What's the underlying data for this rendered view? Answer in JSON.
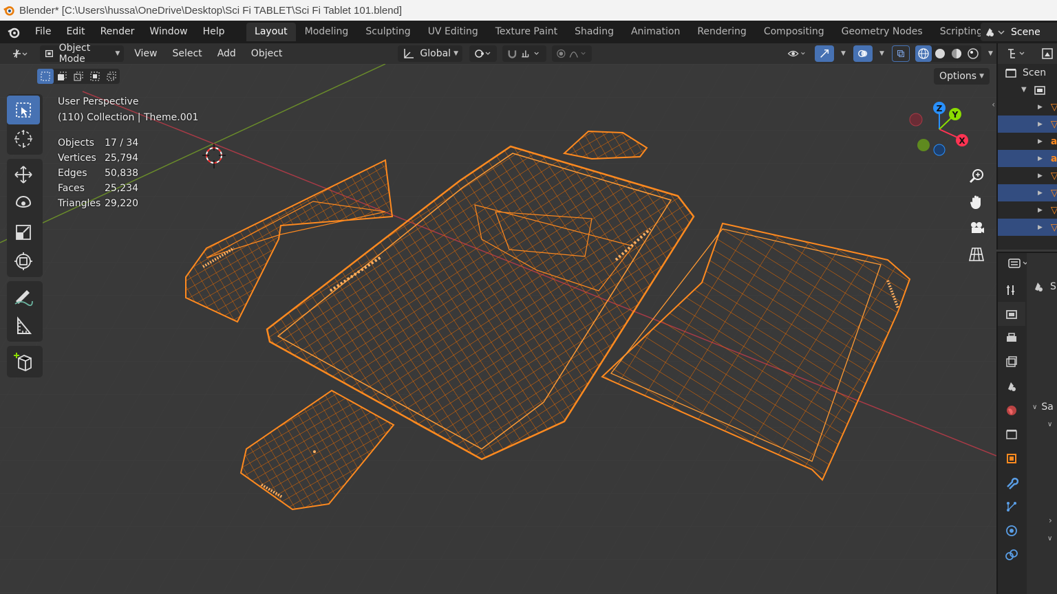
{
  "window": {
    "title": "Blender* [C:\\Users\\hussa\\OneDrive\\Desktop\\Sci Fi TABLET\\Sci Fi Tablet 101.blend]"
  },
  "menu": {
    "items": [
      "File",
      "Edit",
      "Render",
      "Window",
      "Help"
    ]
  },
  "workspaces": {
    "tabs": [
      "Layout",
      "Modeling",
      "Sculpting",
      "UV Editing",
      "Texture Paint",
      "Shading",
      "Animation",
      "Rendering",
      "Compositing",
      "Geometry Nodes",
      "Scripting"
    ],
    "active": "Layout"
  },
  "scene": {
    "label": "Scene"
  },
  "viewport_header": {
    "mode": "Object Mode",
    "menus": [
      "View",
      "Select",
      "Add",
      "Object"
    ],
    "orientation": "Global",
    "options_label": "Options"
  },
  "overlay": {
    "view_name": "User Perspective",
    "collection_info": "(110) Collection | Theme.001",
    "stats": [
      {
        "label": "Objects",
        "value": "17 / 34"
      },
      {
        "label": "Vertices",
        "value": "25,794"
      },
      {
        "label": "Edges",
        "value": "50,838"
      },
      {
        "label": "Faces",
        "value": "25,234"
      },
      {
        "label": "Triangles",
        "value": "29,220"
      }
    ]
  },
  "gizmo": {
    "x": "X",
    "y": "Y",
    "z": "Z"
  },
  "outliner": {
    "header_text": "Scen"
  },
  "properties": {
    "label_s": "S",
    "section_label": "Sa"
  },
  "colors": {
    "wire": "#ff8a1f",
    "wire_dark": "#d65a00",
    "accent_blue": "#4772b3",
    "axis_x": "#ff3352",
    "axis_y": "#8bdc00",
    "axis_z": "#2890ff"
  }
}
